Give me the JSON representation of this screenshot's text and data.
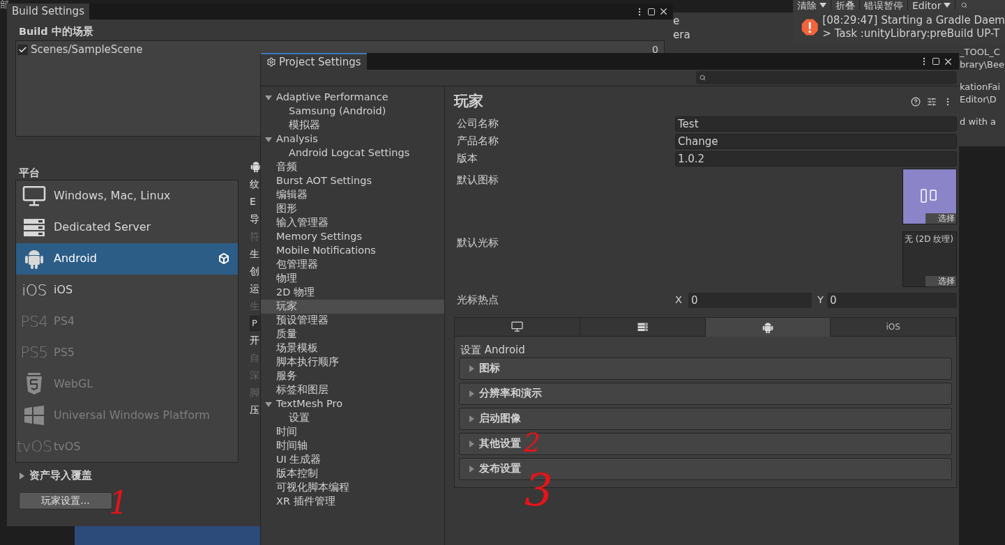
{
  "background": {
    "corner_text": "部",
    "hierarchy_fragments": [
      "e",
      "era"
    ]
  },
  "console": {
    "toolbar": [
      {
        "label": "清除",
        "dropdown": true
      },
      {
        "label": "折叠",
        "dropdown": false
      },
      {
        "label": "错误暂停",
        "dropdown": false
      },
      {
        "label": "Editor",
        "dropdown": true
      }
    ],
    "entries": [
      {
        "kind": "error",
        "lines": [
          "[08:29:47] Starting a Gradle Daem",
          "> Task :unityLibrary:preBuild UP-T"
        ]
      }
    ],
    "fragments": [
      [
        "_TOOL_C",
        "brary\\Bee"
      ],
      [
        "kationFai",
        "Editor\\D"
      ],
      [
        "d with a"
      ]
    ]
  },
  "build_settings": {
    "title": "Build Settings",
    "scenes_heading": "Build 中的场景",
    "scenes": [
      {
        "path": "Scenes/SampleScene",
        "index": "0",
        "checked": true
      }
    ],
    "platforms_heading": "平台",
    "platforms": [
      {
        "label": "Windows, Mac, Linux",
        "kind": "monitor",
        "selected": false,
        "disabled": false,
        "active": false
      },
      {
        "label": "Dedicated Server",
        "kind": "server",
        "selected": false,
        "disabled": false,
        "active": false
      },
      {
        "label": "Android",
        "kind": "android",
        "selected": true,
        "disabled": false,
        "active": true
      },
      {
        "label": "iOS",
        "kind": "text",
        "logo": "iOS",
        "selected": false,
        "disabled": false,
        "active": false
      },
      {
        "label": "PS4",
        "kind": "text",
        "logo": "PS4",
        "selected": false,
        "disabled": true,
        "active": false
      },
      {
        "label": "PS5",
        "kind": "text",
        "logo": "PS5",
        "selected": false,
        "disabled": true,
        "active": false
      },
      {
        "label": "WebGL",
        "kind": "html5",
        "selected": false,
        "disabled": true,
        "active": false
      },
      {
        "label": "Universal Windows Platform",
        "kind": "windows",
        "selected": false,
        "disabled": true,
        "active": false
      },
      {
        "label": "tvOS",
        "kind": "text",
        "logo": "tvOS",
        "selected": false,
        "disabled": true,
        "active": false
      }
    ],
    "side_fragments": [
      {
        "kind": "text",
        "text": "纹",
        "disabled": false
      },
      {
        "kind": "text",
        "text": "E",
        "disabled": false
      },
      {
        "kind": "text",
        "text": "导",
        "disabled": false
      },
      {
        "kind": "text",
        "text": "符",
        "disabled": true
      },
      {
        "kind": "text",
        "text": "生",
        "disabled": false
      },
      {
        "kind": "text",
        "text": "创",
        "disabled": false
      },
      {
        "kind": "text",
        "text": "运",
        "disabled": false
      },
      {
        "kind": "text",
        "text": "生",
        "disabled": true
      },
      {
        "kind": "field",
        "text": "P"
      },
      {
        "kind": "text",
        "text": "开",
        "disabled": false
      },
      {
        "kind": "text",
        "text": "自",
        "disabled": true
      },
      {
        "kind": "text",
        "text": "深",
        "disabled": true
      },
      {
        "kind": "text",
        "text": "脚",
        "disabled": true
      },
      {
        "kind": "text",
        "text": "压",
        "disabled": false
      }
    ],
    "asset_override": {
      "label": "资产导入覆盖",
      "expanded": false
    },
    "player_settings_button": "玩家设置..."
  },
  "project_settings": {
    "title": "Project Settings",
    "tree": [
      {
        "label": "Adaptive Performance",
        "expanded": true,
        "selected": false,
        "children": [
          {
            "label": "Samsung (Android)",
            "selected": false
          },
          {
            "label": "模拟器",
            "selected": false
          }
        ]
      },
      {
        "label": "Analysis",
        "expanded": true,
        "selected": false,
        "children": [
          {
            "label": "Android Logcat Settings",
            "selected": false
          }
        ]
      },
      {
        "label": "音频",
        "selected": false
      },
      {
        "label": "Burst AOT Settings",
        "selected": false
      },
      {
        "label": "编辑器",
        "selected": false
      },
      {
        "label": "图形",
        "selected": false
      },
      {
        "label": "输入管理器",
        "selected": false
      },
      {
        "label": "Memory Settings",
        "selected": false
      },
      {
        "label": "Mobile Notifications",
        "selected": false
      },
      {
        "label": "包管理器",
        "selected": false
      },
      {
        "label": "物理",
        "selected": false
      },
      {
        "label": "2D 物理",
        "selected": false
      },
      {
        "label": "玩家",
        "selected": true
      },
      {
        "label": "预设管理器",
        "selected": false
      },
      {
        "label": "质量",
        "selected": false
      },
      {
        "label": "场景模板",
        "selected": false
      },
      {
        "label": "脚本执行顺序",
        "selected": false
      },
      {
        "label": "服务",
        "selected": false
      },
      {
        "label": "标签和图层",
        "selected": false
      },
      {
        "label": "TextMesh Pro",
        "expanded": true,
        "selected": false,
        "children": [
          {
            "label": "设置",
            "selected": false
          }
        ]
      },
      {
        "label": "时间",
        "selected": false
      },
      {
        "label": "时间轴",
        "selected": false
      },
      {
        "label": "UI 生成器",
        "selected": false
      },
      {
        "label": "版本控制",
        "selected": false
      },
      {
        "label": "可视化脚本编程",
        "selected": false
      },
      {
        "label": "XR 插件管理",
        "selected": false
      }
    ],
    "section_title": "玩家",
    "fields": [
      {
        "label": "公司名称",
        "value": "Test"
      },
      {
        "label": "产品名称",
        "value": "Change"
      },
      {
        "label": "版本",
        "value": "1.0.2"
      }
    ],
    "texture_slots": [
      {
        "label": "默认图标",
        "kind": "image",
        "button": "选择"
      },
      {
        "label": "默认光标",
        "kind": "empty",
        "caption": "无 (2D 纹理)",
        "button": "选择"
      }
    ],
    "hotspot": {
      "label": "光标热点",
      "x_label": "X",
      "x_value": "0",
      "y_label": "Y",
      "y_value": "0"
    },
    "platform_tabs": [
      {
        "kind": "monitor",
        "selected": false
      },
      {
        "kind": "server",
        "selected": false
      },
      {
        "kind": "android",
        "selected": true
      },
      {
        "kind": "text",
        "label": "iOS",
        "selected": false
      }
    ],
    "platform_heading": "设置 Android",
    "foldouts": [
      {
        "label": "图标",
        "expanded": false
      },
      {
        "label": "分辨率和演示",
        "expanded": false
      },
      {
        "label": "启动图像",
        "expanded": false
      },
      {
        "label": "其他设置",
        "expanded": false,
        "annotation": "2"
      },
      {
        "label": "发布设置",
        "expanded": false
      }
    ]
  },
  "annotations": [
    {
      "text": "1"
    },
    {
      "text": "3"
    }
  ]
}
